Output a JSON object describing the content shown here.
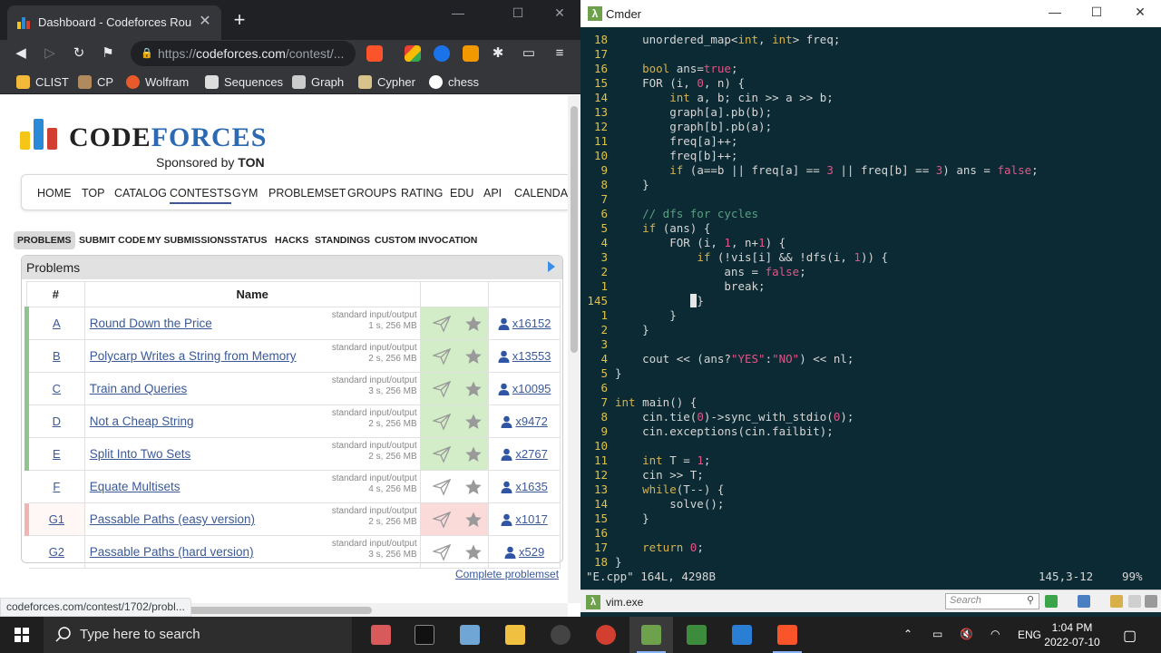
{
  "browser": {
    "tab_title": "Dashboard - Codeforces Round #",
    "tab_close": "✕",
    "new_tab": "+",
    "url_host": "codeforces.com",
    "url_prefix": "https://",
    "url_rest": "/contest/...",
    "bookmarks": [
      "CLIST",
      "CP",
      "Wolfram",
      "Sequences",
      "Graph",
      "Cypher",
      "chess"
    ],
    "status_url": "codeforces.com/contest/1702/probl..."
  },
  "site": {
    "logo_code": "Code",
    "logo_forces": "forces",
    "sponsor_text": "Sponsored by",
    "sponsor_name": "TON",
    "nav": [
      "HOME",
      "TOP",
      "CATALOG",
      "CONTESTS",
      "GYM",
      "PROBLEMSET",
      "GROUPS",
      "RATING",
      "EDU",
      "API",
      "CALENDAR"
    ],
    "nav_active": "CONTESTS",
    "subnav": [
      "PROBLEMS",
      "SUBMIT CODE",
      "MY SUBMISSIONS",
      "STATUS",
      "HACKS",
      "STANDINGS",
      "CUSTOM INVOCATION"
    ],
    "subnav_active": "PROBLEMS",
    "problems_title": "Problems",
    "col_idx": "#",
    "col_name": "Name",
    "problems": [
      {
        "idx": "A",
        "name": "Round Down the Price",
        "io": "standard input/output",
        "limits": "1 s, 256 MB",
        "solved": "x16152",
        "status": "green"
      },
      {
        "idx": "B",
        "name": "Polycarp Writes a String from Memory",
        "io": "standard input/output",
        "limits": "2 s, 256 MB",
        "solved": "x13553",
        "status": "green"
      },
      {
        "idx": "C",
        "name": "Train and Queries",
        "io": "standard input/output",
        "limits": "3 s, 256 MB",
        "solved": "x10095",
        "status": "green"
      },
      {
        "idx": "D",
        "name": "Not a Cheap String",
        "io": "standard input/output",
        "limits": "2 s, 256 MB",
        "solved": "x9472",
        "status": "green"
      },
      {
        "idx": "E",
        "name": "Split Into Two Sets",
        "io": "standard input/output",
        "limits": "2 s, 256 MB",
        "solved": "x2767",
        "status": "green"
      },
      {
        "idx": "F",
        "name": "Equate Multisets",
        "io": "standard input/output",
        "limits": "4 s, 256 MB",
        "solved": "x1635",
        "status": "white"
      },
      {
        "idx": "G1",
        "name": "Passable Paths (easy version)",
        "io": "standard input/output",
        "limits": "2 s, 256 MB",
        "solved": "x1017",
        "status": "red"
      },
      {
        "idx": "G2",
        "name": "Passable Paths (hard version)",
        "io": "standard input/output",
        "limits": "3 s, 256 MB",
        "solved": "x529",
        "status": "white"
      }
    ],
    "complete_link": "Complete problemset"
  },
  "cmder": {
    "title": "Cmder",
    "tab_label": "vim.exe",
    "search_placeholder": "Search",
    "status_file": "\"E.cpp\" 164L, 4298B",
    "status_pos": "145,3-12",
    "status_pct": "99%",
    "lines": [
      {
        "n": "18",
        "code": "    unordered_map<int, int> freq;"
      },
      {
        "n": "17",
        "code": ""
      },
      {
        "n": "16",
        "code": "    bool ans=true;"
      },
      {
        "n": "15",
        "code": "    FOR (i, 0, n) {"
      },
      {
        "n": "14",
        "code": "        int a, b; cin >> a >> b;"
      },
      {
        "n": "13",
        "code": "        graph[a].pb(b);"
      },
      {
        "n": "12",
        "code": "        graph[b].pb(a);"
      },
      {
        "n": "11",
        "code": "        freq[a]++;"
      },
      {
        "n": "10",
        "code": "        freq[b]++;"
      },
      {
        "n": "9",
        "code": "        if (a==b || freq[a] == 3 || freq[b] == 3) ans = false;"
      },
      {
        "n": "8",
        "code": "    }"
      },
      {
        "n": "7",
        "code": ""
      },
      {
        "n": "6",
        "code": "    // dfs for cycles"
      },
      {
        "n": "5",
        "code": "    if (ans) {"
      },
      {
        "n": "4",
        "code": "        FOR (i, 1, n+1) {"
      },
      {
        "n": "3",
        "code": "            if (!vis[i] && !dfs(i, 1)) {"
      },
      {
        "n": "2",
        "code": "                ans = false;"
      },
      {
        "n": "1",
        "code": "                break;"
      },
      {
        "n": "145",
        "code": "            }"
      },
      {
        "n": "1",
        "code": "        }"
      },
      {
        "n": "2",
        "code": "    }"
      },
      {
        "n": "3",
        "code": ""
      },
      {
        "n": "4",
        "code": "    cout << (ans?\"YES\":\"NO\") << nl;"
      },
      {
        "n": "5",
        "code": "}"
      },
      {
        "n": "6",
        "code": ""
      },
      {
        "n": "7",
        "code": "int main() {"
      },
      {
        "n": "8",
        "code": "    cin.tie(0)->sync_with_stdio(0);"
      },
      {
        "n": "9",
        "code": "    cin.exceptions(cin.failbit);"
      },
      {
        "n": "10",
        "code": ""
      },
      {
        "n": "11",
        "code": "    int T = 1;"
      },
      {
        "n": "12",
        "code": "    cin >> T;"
      },
      {
        "n": "13",
        "code": "    while(T--) {"
      },
      {
        "n": "14",
        "code": "        solve();"
      },
      {
        "n": "15",
        "code": "    }"
      },
      {
        "n": "16",
        "code": ""
      },
      {
        "n": "17",
        "code": "    return 0;"
      },
      {
        "n": "18",
        "code": "}"
      }
    ]
  },
  "taskbar": {
    "search_placeholder": "Type here to search",
    "lang": "ENG",
    "time": "1:04 PM",
    "date": "2022-07-10"
  },
  "colors": {
    "green_row": "#d4edc9",
    "red_row": "#fbdada",
    "accent_link": "#3b5998",
    "terminal_bg": "#0c2a33"
  }
}
